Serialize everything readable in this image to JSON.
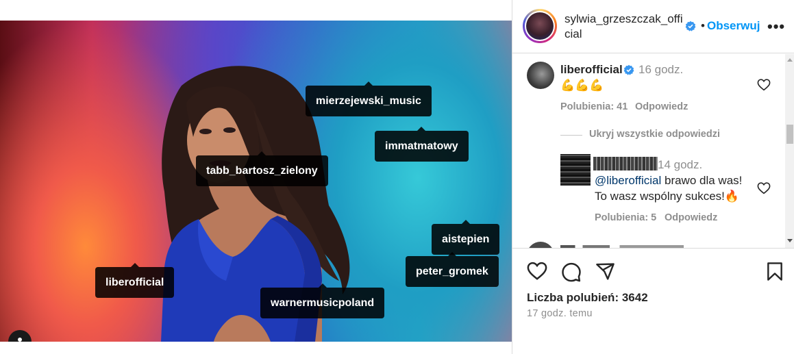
{
  "post": {
    "tags": [
      {
        "name": "mierzejewski_music"
      },
      {
        "name": "immatmatowy"
      },
      {
        "name": "tabb_bartosz_zielony"
      },
      {
        "name": "aistepien"
      },
      {
        "name": "peter_gromek"
      },
      {
        "name": "liberofficial"
      },
      {
        "name": "warnermusicpoland"
      }
    ]
  },
  "header": {
    "username": "sylwia_grzeszczak_official",
    "dot": "•",
    "follow_label": "Obserwuj",
    "more_label": "•••"
  },
  "comments": [
    {
      "user": "liberofficial",
      "time": "16 godz.",
      "text": "💪💪💪",
      "likes_label": "Polubienia: 41",
      "reply_label": "Odpowiedz"
    }
  ],
  "hide_replies_label": "Ukryj wszystkie odpowiedzi",
  "reply": {
    "time": "14 godz.",
    "mention": "@liberofficial",
    "text_after_mention": " brawo dla was!",
    "text_line2": "To wasz wspólny sukces!🔥",
    "likes_label": "Polubienia: 5",
    "reply_label": "Odpowiedz"
  },
  "actions": {
    "likes_text": "Liczba polubień: 3642",
    "posted_text": "17 godz. temu"
  },
  "colors": {
    "accent": "#0095f6",
    "verified": "#3897f0",
    "mention": "#00376b",
    "muted": "#8e8e8e"
  },
  "icons": [
    "verified-badge-icon",
    "heart-icon",
    "comment-icon",
    "share-icon",
    "bookmark-icon",
    "user-tag-icon",
    "more-icon"
  ]
}
